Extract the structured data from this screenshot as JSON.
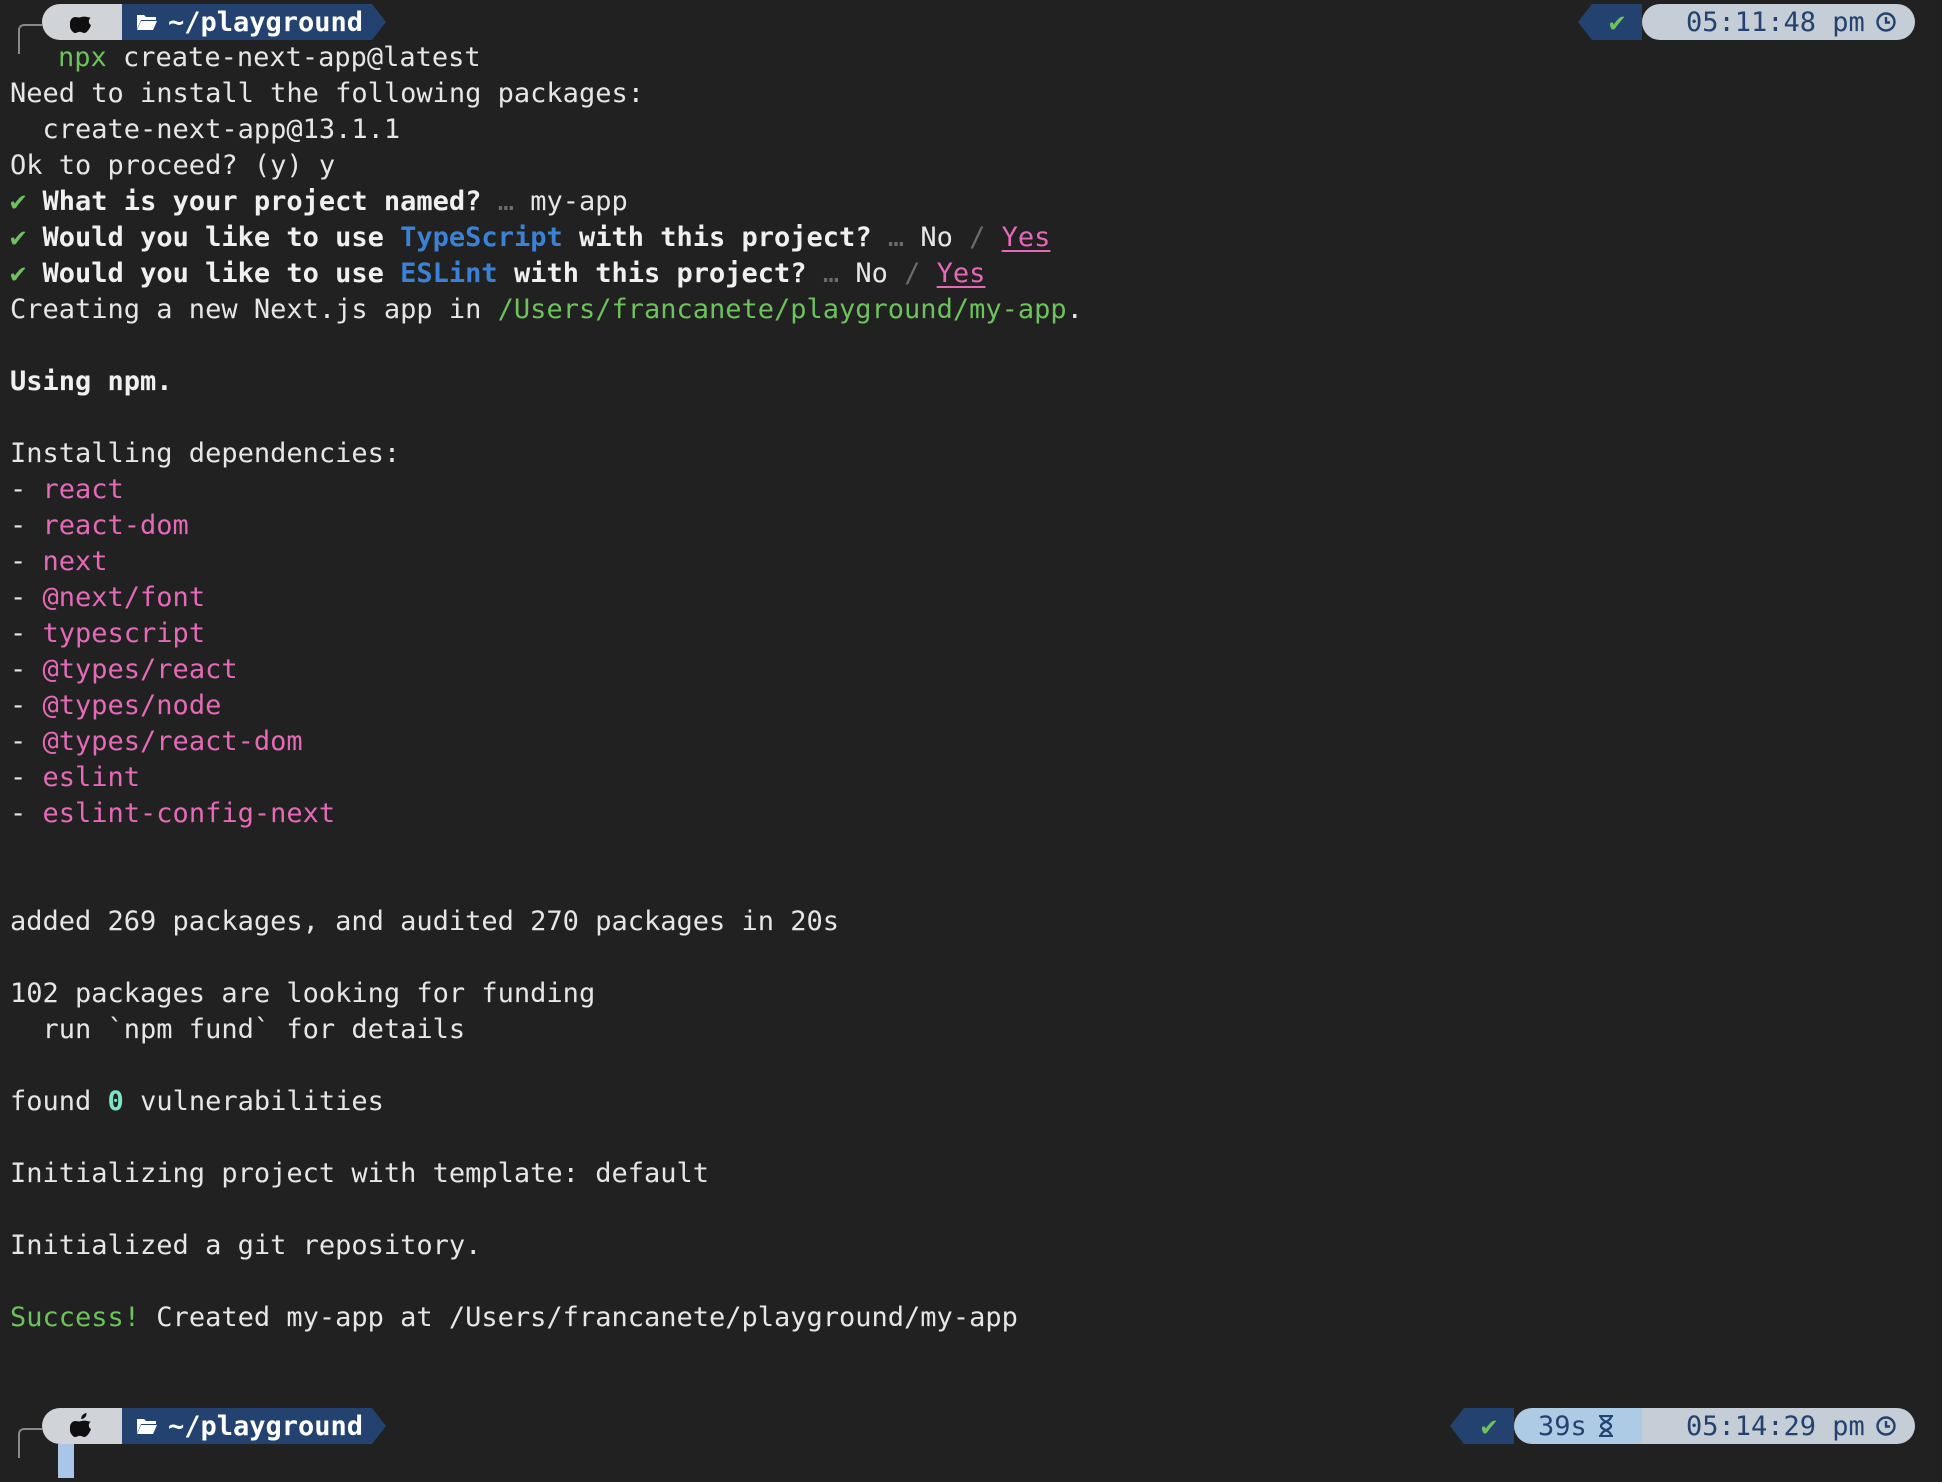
{
  "prompt_top": {
    "dir": "~/playground",
    "status": "✔",
    "time": "05:11:48 pm"
  },
  "command": {
    "prefix": "npx",
    "rest": " create-next-app@latest"
  },
  "install": {
    "need": "Need to install the following packages:",
    "pkg": "  create-next-app@13.1.1",
    "proceed": "Ok to proceed? (y) y"
  },
  "questions": [
    {
      "check": "✔",
      "q": "What is your project named?",
      "sep": " … ",
      "answer": "my-app"
    },
    {
      "check": "✔",
      "pre": "Would you like to use ",
      "tech": "TypeScript",
      "post": " with this project?",
      "sep": " … ",
      "no": "No",
      "slash": " / ",
      "yes": "Yes"
    },
    {
      "check": "✔",
      "pre": "Would you like to use ",
      "tech": "ESLint",
      "post": " with this project?",
      "sep": " … ",
      "no": "No",
      "slash": " / ",
      "yes": "Yes"
    }
  ],
  "creating": {
    "text": "Creating a new Next.js app in ",
    "path": "/Users/francanete/playground/my-app",
    "dot": "."
  },
  "using": "Using npm.",
  "installing": "Installing dependencies:",
  "deps": [
    "react",
    "react-dom",
    "next",
    "@next/font",
    "typescript",
    "@types/react",
    "@types/node",
    "@types/react-dom",
    "eslint",
    "eslint-config-next"
  ],
  "dash": "- ",
  "added": "added 269 packages, and audited 270 packages in 20s",
  "funding1": "102 packages are looking for funding",
  "funding2": "  run `npm fund` for details",
  "found": {
    "pre": "found ",
    "num": "0",
    "post": " vulnerabilities"
  },
  "init_template": "Initializing project with template: default",
  "init_git": "Initialized a git repository.",
  "success": {
    "label": "Success!",
    "text": " Created my-app at /Users/francanete/playground/my-app"
  },
  "prompt_bottom": {
    "dir": "~/playground",
    "status": "✔",
    "duration": "39s",
    "time": "05:14:29 pm"
  }
}
